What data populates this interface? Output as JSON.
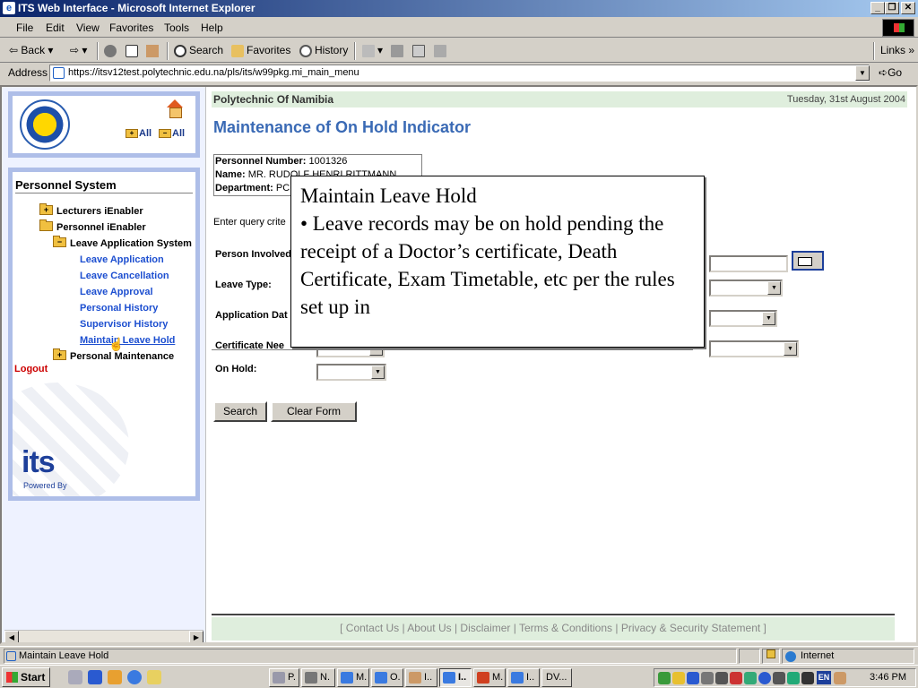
{
  "window": {
    "title": "ITS Web Interface - Microsoft Internet Explorer",
    "minimize": "_",
    "restore": "❐",
    "close": "✕"
  },
  "menubar": [
    "File",
    "Edit",
    "View",
    "Favorites",
    "Tools",
    "Help"
  ],
  "toolbar": {
    "back": "Back",
    "search": "Search",
    "favorites": "Favorites",
    "history": "History",
    "links": "Links"
  },
  "address": {
    "label": "Address",
    "url": "https://itsv12test.polytechnic.edu.na/pls/its/w99pkg.mi_main_menu",
    "go": "Go"
  },
  "sidebar": {
    "expand_all": "All",
    "collapse_all": "All",
    "menu_title": "Personnel System",
    "items": [
      {
        "label": "Lecturers iEnabler"
      },
      {
        "label": "Personnel iEnabler"
      },
      {
        "label": "Leave Application System"
      },
      {
        "label": "Leave Application"
      },
      {
        "label": "Leave Cancellation"
      },
      {
        "label": "Leave Approval"
      },
      {
        "label": "Personal History"
      },
      {
        "label": "Supervisor History"
      },
      {
        "label": "Maintain Leave Hold"
      },
      {
        "label": "Personal Maintenance"
      }
    ],
    "logout": "Logout",
    "brand_logo": "its",
    "powered_by": "Powered By"
  },
  "main": {
    "institution": "Polytechnic Of Namibia",
    "date": "Tuesday, 31st August 2004",
    "page_title": "Maintenance of On Hold Indicator",
    "person": {
      "number_label": "Personnel Number:",
      "number": "1001326",
      "name_label": "Name:",
      "name": "MR. RUDOLF HENRI RITTMANN",
      "department_label": "Department:",
      "department": "PC"
    },
    "query_text": "Enter query crite",
    "fields": {
      "person_involved": "Person Involved",
      "leave_type": "Leave Type:",
      "application_date": "Application Dat",
      "certificate_needed": "Certificate Nee",
      "on_hold": "On Hold:"
    },
    "buttons": {
      "search": "Search",
      "clear": "Clear Form"
    },
    "footer": "[ Contact Us | About Us | Disclaimer | Terms & Conditions | Privacy & Security Statement ]"
  },
  "overlay": {
    "title": "Maintain Leave Hold",
    "body": "• Leave records may be on hold pending the receipt of a Doctor’s certificate, Death Certificate, Exam Timetable, etc per the rules set up in"
  },
  "statusbar": {
    "text": "Maintain Leave Hold",
    "zone": "Internet"
  },
  "taskbar": {
    "start": "Start",
    "tasks": [
      "P.",
      "N.",
      "M.",
      "O.",
      "I..",
      "I..",
      "M.",
      "I..",
      "DV..."
    ],
    "lang": "EN",
    "clock": "3:46 PM"
  }
}
